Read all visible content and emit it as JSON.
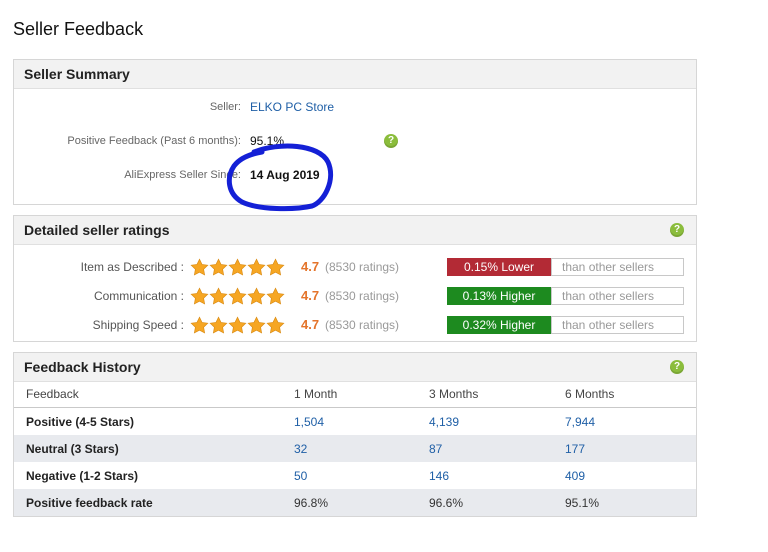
{
  "page": {
    "title": "Seller Feedback"
  },
  "summary": {
    "title": "Seller Summary",
    "seller_label": "Seller:",
    "seller_name": "ELKO PC Store",
    "positive_label": "Positive Feedback (Past 6 months):",
    "positive_value": "95.1%",
    "since_label": "AliExpress Seller Since:",
    "since_value": "14 Aug 2019",
    "help": "?"
  },
  "ratings": {
    "title": "Detailed seller ratings",
    "help": "?",
    "comparison_suffix": "than other sellers",
    "rows": [
      {
        "label": "Item as Described :",
        "stars": 5,
        "score": "4.7",
        "count": "(8530 ratings)",
        "comparison": "0.15% Lower",
        "comparison_color": "#b32a35"
      },
      {
        "label": "Communication :",
        "stars": 5,
        "score": "4.7",
        "count": "(8530 ratings)",
        "comparison": "0.13% Higher",
        "comparison_color": "#1d8a1f"
      },
      {
        "label": "Shipping Speed :",
        "stars": 5,
        "score": "4.7",
        "count": "(8530 ratings)",
        "comparison": "0.32% Higher",
        "comparison_color": "#1d8a1f"
      }
    ]
  },
  "history": {
    "title": "Feedback History",
    "help": "?",
    "columns": [
      "Feedback",
      "1 Month",
      "3 Months",
      "6 Months"
    ],
    "rows": [
      {
        "label": "Positive (4-5 Stars)",
        "values": [
          "1,504",
          "4,139",
          "7,944"
        ]
      },
      {
        "label": "Neutral (3 Stars)",
        "values": [
          "32",
          "87",
          "177"
        ]
      },
      {
        "label": "Negative (1-2 Stars)",
        "values": [
          "50",
          "146",
          "409"
        ]
      },
      {
        "label": "Positive feedback rate",
        "values": [
          "96.8%",
          "96.6%",
          "95.1%"
        ]
      }
    ]
  },
  "colors": {
    "star": "#f6a623",
    "score": "#e4742b",
    "link": "#1f5fa6",
    "annotation": "#1420d6",
    "help": "#8bbd3c"
  }
}
